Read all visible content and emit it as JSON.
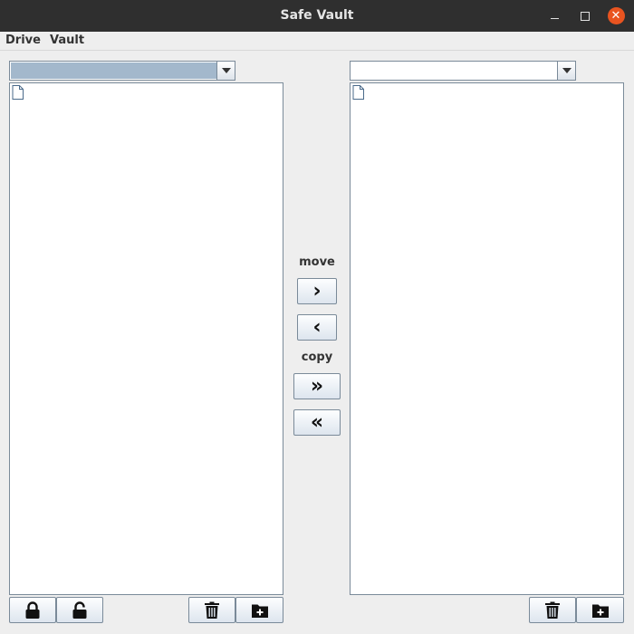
{
  "window": {
    "title": "Safe Vault"
  },
  "menu": {
    "items": [
      "Drive",
      "Vault"
    ]
  },
  "center": {
    "move_label": "move",
    "copy_label": "copy",
    "move_right_glyph": "›",
    "move_left_glyph": "‹",
    "copy_right_glyph": "»",
    "copy_left_glyph": "«"
  },
  "left_panel": {
    "drive_selected_value": "",
    "buttons": [
      "lock-icon",
      "unlock-icon",
      "trash-icon",
      "folder-add-icon"
    ]
  },
  "right_panel": {
    "drive_selected_value": "",
    "buttons": [
      "trash-icon",
      "folder-add-icon"
    ]
  },
  "colors": {
    "accent": "#a3b8cc",
    "close": "#e95420",
    "titlebar": "#2f2f2f"
  }
}
